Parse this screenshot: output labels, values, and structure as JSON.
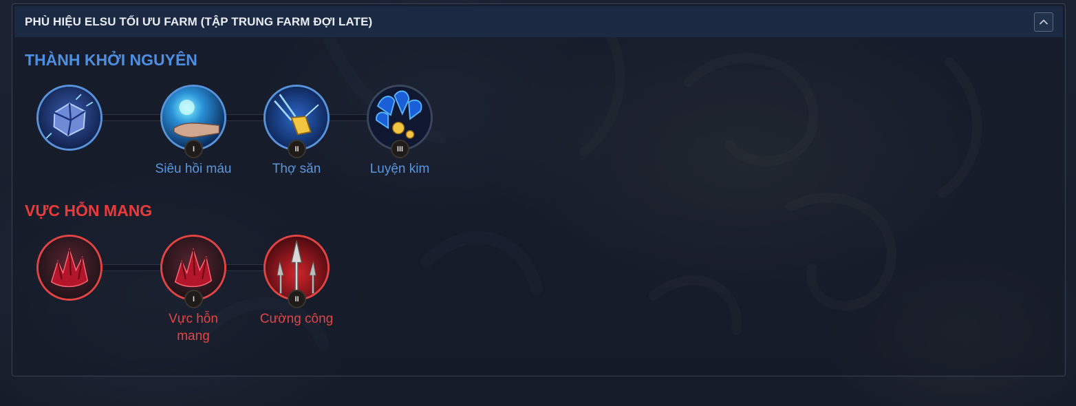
{
  "panel": {
    "title": "PHÙ HIỆU ELSU TỐI ƯU FARM (TẬP TRUNG FARM ĐỢI LATE)",
    "collapse_icon": "chevron-up-icon"
  },
  "trees": [
    {
      "title": "THÀNH KHỞI NGUYÊN",
      "color": "#4d8fe0",
      "nodes": [
        {
          "icon": "blue-crystal-cube-icon",
          "tier": "",
          "label": ""
        },
        {
          "icon": "healing-hand-icon",
          "tier": "I",
          "label": "Siêu hồi máu"
        },
        {
          "icon": "hunter-arrow-icon",
          "tier": "II",
          "label": "Thợ săn"
        },
        {
          "icon": "alchemy-claw-icon",
          "tier": "III",
          "label": "Luyện kim"
        }
      ]
    },
    {
      "title": "VỰC HỖN MANG",
      "color": "#ea3a3a",
      "nodes": [
        {
          "icon": "red-crystal-icon",
          "tier": "",
          "label": ""
        },
        {
          "icon": "red-crystal-icon",
          "tier": "I",
          "label": "Vực hỗn\nmang"
        },
        {
          "icon": "spear-blades-icon",
          "tier": "II",
          "label": "Cường công"
        }
      ]
    }
  ]
}
